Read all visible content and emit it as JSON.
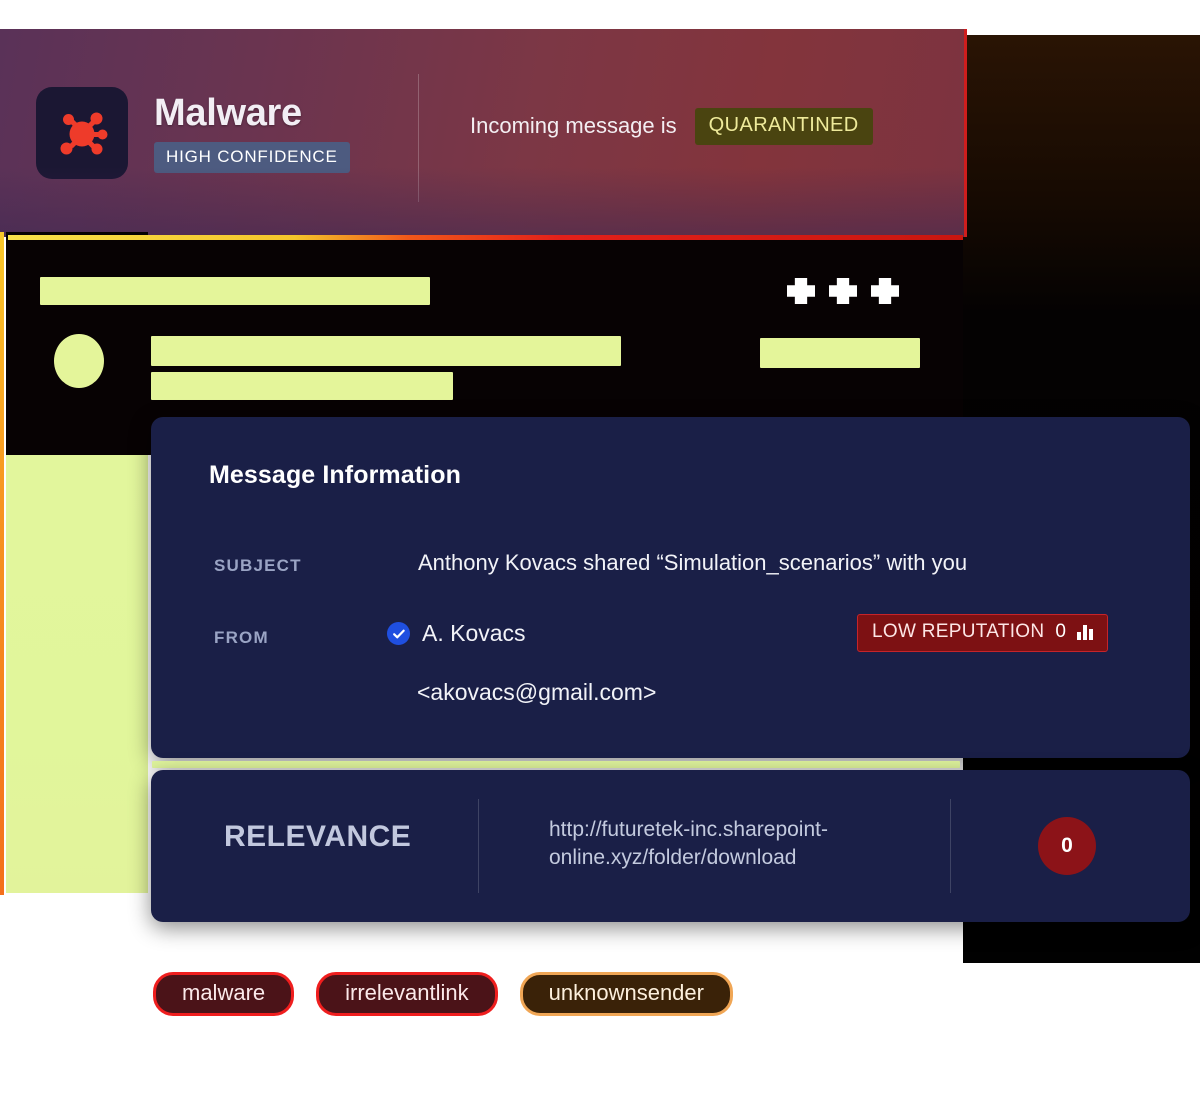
{
  "verdict_banner": {
    "threat_icon": "malware-bug-icon",
    "threat_name": "Malware",
    "confidence_label": "HIGH CONFIDENCE",
    "disposition_prefix": "Incoming message is",
    "disposition_status": "QUARANTINED",
    "colors": {
      "gradient_start": "#5a3258",
      "gradient_end": "#7c3340",
      "confidence_chip_bg": "#4d5b80",
      "quarantine_chip_bg": "#4a4410",
      "quarantine_chip_text": "#eeea9a",
      "icon_red": "#ee3b2a",
      "border_red": "#cf1d1d"
    }
  },
  "redacted_strip": {
    "note": "redacted email preview",
    "highlight_color": "#e4f59a",
    "background": "#070203",
    "accent_rule": "yellow-to-red"
  },
  "message_info": {
    "heading": "Message Information",
    "fields": [
      {
        "label": "SUBJECT",
        "value": "Anthony Kovacs shared “Simulation_scenarios” with you"
      },
      {
        "label": "FROM",
        "value": "A. Kovacs",
        "email": "<akovacs@gmail.com>",
        "verified_icon": "verified-check-icon"
      }
    ],
    "subject_label": "SUBJECT",
    "subject_value": "Anthony Kovacs shared “Simulation_scenarios” with you",
    "from_label": "FROM",
    "from_name": "A. Kovacs",
    "from_email": "<akovacs@gmail.com>",
    "reputation": {
      "label": "LOW REPUTATION",
      "score": "0",
      "icon": "bar-chart-icon",
      "bg": "#7d1113",
      "border": "#c6242a"
    },
    "card_bg": "#1a1f47"
  },
  "relevance": {
    "title": "RELEVANCE",
    "url": "http://futuretek-inc.sharepoint-online.xyz/folder/download",
    "score": "0",
    "score_bg": "#8c1318",
    "card_bg": "#1a1f47",
    "seam_color": "#dff49c"
  },
  "tags": [
    {
      "label": "malware",
      "severity": "danger",
      "border": "#ef1e1e",
      "bg": "#4b1318"
    },
    {
      "label": "irrelevantlink",
      "severity": "danger",
      "border": "#ef1e1e",
      "bg": "#4b1318"
    },
    {
      "label": "unknownsender",
      "severity": "warning",
      "border": "#f0a655",
      "bg": "#3a2208"
    }
  ],
  "decor": {
    "left_rail_color": "#f79521",
    "green_block_color": "#e2f69c"
  }
}
